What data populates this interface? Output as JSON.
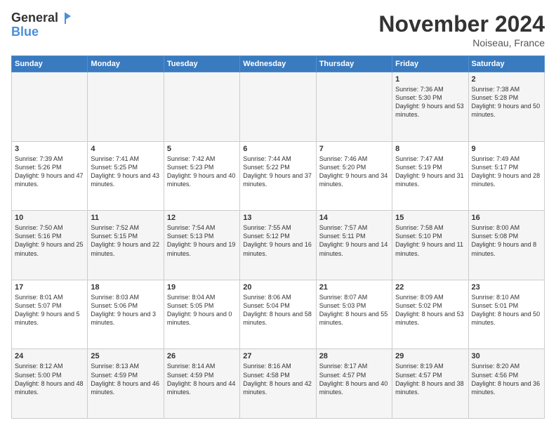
{
  "header": {
    "logo_line1": "General",
    "logo_line2": "Blue",
    "month_title": "November 2024",
    "location": "Noiseau, France"
  },
  "days_of_week": [
    "Sunday",
    "Monday",
    "Tuesday",
    "Wednesday",
    "Thursday",
    "Friday",
    "Saturday"
  ],
  "weeks": [
    [
      {
        "day": "",
        "text": ""
      },
      {
        "day": "",
        "text": ""
      },
      {
        "day": "",
        "text": ""
      },
      {
        "day": "",
        "text": ""
      },
      {
        "day": "",
        "text": ""
      },
      {
        "day": "1",
        "text": "Sunrise: 7:36 AM\nSunset: 5:30 PM\nDaylight: 9 hours and 53 minutes."
      },
      {
        "day": "2",
        "text": "Sunrise: 7:38 AM\nSunset: 5:28 PM\nDaylight: 9 hours and 50 minutes."
      }
    ],
    [
      {
        "day": "3",
        "text": "Sunrise: 7:39 AM\nSunset: 5:26 PM\nDaylight: 9 hours and 47 minutes."
      },
      {
        "day": "4",
        "text": "Sunrise: 7:41 AM\nSunset: 5:25 PM\nDaylight: 9 hours and 43 minutes."
      },
      {
        "day": "5",
        "text": "Sunrise: 7:42 AM\nSunset: 5:23 PM\nDaylight: 9 hours and 40 minutes."
      },
      {
        "day": "6",
        "text": "Sunrise: 7:44 AM\nSunset: 5:22 PM\nDaylight: 9 hours and 37 minutes."
      },
      {
        "day": "7",
        "text": "Sunrise: 7:46 AM\nSunset: 5:20 PM\nDaylight: 9 hours and 34 minutes."
      },
      {
        "day": "8",
        "text": "Sunrise: 7:47 AM\nSunset: 5:19 PM\nDaylight: 9 hours and 31 minutes."
      },
      {
        "day": "9",
        "text": "Sunrise: 7:49 AM\nSunset: 5:17 PM\nDaylight: 9 hours and 28 minutes."
      }
    ],
    [
      {
        "day": "10",
        "text": "Sunrise: 7:50 AM\nSunset: 5:16 PM\nDaylight: 9 hours and 25 minutes."
      },
      {
        "day": "11",
        "text": "Sunrise: 7:52 AM\nSunset: 5:15 PM\nDaylight: 9 hours and 22 minutes."
      },
      {
        "day": "12",
        "text": "Sunrise: 7:54 AM\nSunset: 5:13 PM\nDaylight: 9 hours and 19 minutes."
      },
      {
        "day": "13",
        "text": "Sunrise: 7:55 AM\nSunset: 5:12 PM\nDaylight: 9 hours and 16 minutes."
      },
      {
        "day": "14",
        "text": "Sunrise: 7:57 AM\nSunset: 5:11 PM\nDaylight: 9 hours and 14 minutes."
      },
      {
        "day": "15",
        "text": "Sunrise: 7:58 AM\nSunset: 5:10 PM\nDaylight: 9 hours and 11 minutes."
      },
      {
        "day": "16",
        "text": "Sunrise: 8:00 AM\nSunset: 5:08 PM\nDaylight: 9 hours and 8 minutes."
      }
    ],
    [
      {
        "day": "17",
        "text": "Sunrise: 8:01 AM\nSunset: 5:07 PM\nDaylight: 9 hours and 5 minutes."
      },
      {
        "day": "18",
        "text": "Sunrise: 8:03 AM\nSunset: 5:06 PM\nDaylight: 9 hours and 3 minutes."
      },
      {
        "day": "19",
        "text": "Sunrise: 8:04 AM\nSunset: 5:05 PM\nDaylight: 9 hours and 0 minutes."
      },
      {
        "day": "20",
        "text": "Sunrise: 8:06 AM\nSunset: 5:04 PM\nDaylight: 8 hours and 58 minutes."
      },
      {
        "day": "21",
        "text": "Sunrise: 8:07 AM\nSunset: 5:03 PM\nDaylight: 8 hours and 55 minutes."
      },
      {
        "day": "22",
        "text": "Sunrise: 8:09 AM\nSunset: 5:02 PM\nDaylight: 8 hours and 53 minutes."
      },
      {
        "day": "23",
        "text": "Sunrise: 8:10 AM\nSunset: 5:01 PM\nDaylight: 8 hours and 50 minutes."
      }
    ],
    [
      {
        "day": "24",
        "text": "Sunrise: 8:12 AM\nSunset: 5:00 PM\nDaylight: 8 hours and 48 minutes."
      },
      {
        "day": "25",
        "text": "Sunrise: 8:13 AM\nSunset: 4:59 PM\nDaylight: 8 hours and 46 minutes."
      },
      {
        "day": "26",
        "text": "Sunrise: 8:14 AM\nSunset: 4:59 PM\nDaylight: 8 hours and 44 minutes."
      },
      {
        "day": "27",
        "text": "Sunrise: 8:16 AM\nSunset: 4:58 PM\nDaylight: 8 hours and 42 minutes."
      },
      {
        "day": "28",
        "text": "Sunrise: 8:17 AM\nSunset: 4:57 PM\nDaylight: 8 hours and 40 minutes."
      },
      {
        "day": "29",
        "text": "Sunrise: 8:19 AM\nSunset: 4:57 PM\nDaylight: 8 hours and 38 minutes."
      },
      {
        "day": "30",
        "text": "Sunrise: 8:20 AM\nSunset: 4:56 PM\nDaylight: 8 hours and 36 minutes."
      }
    ]
  ]
}
